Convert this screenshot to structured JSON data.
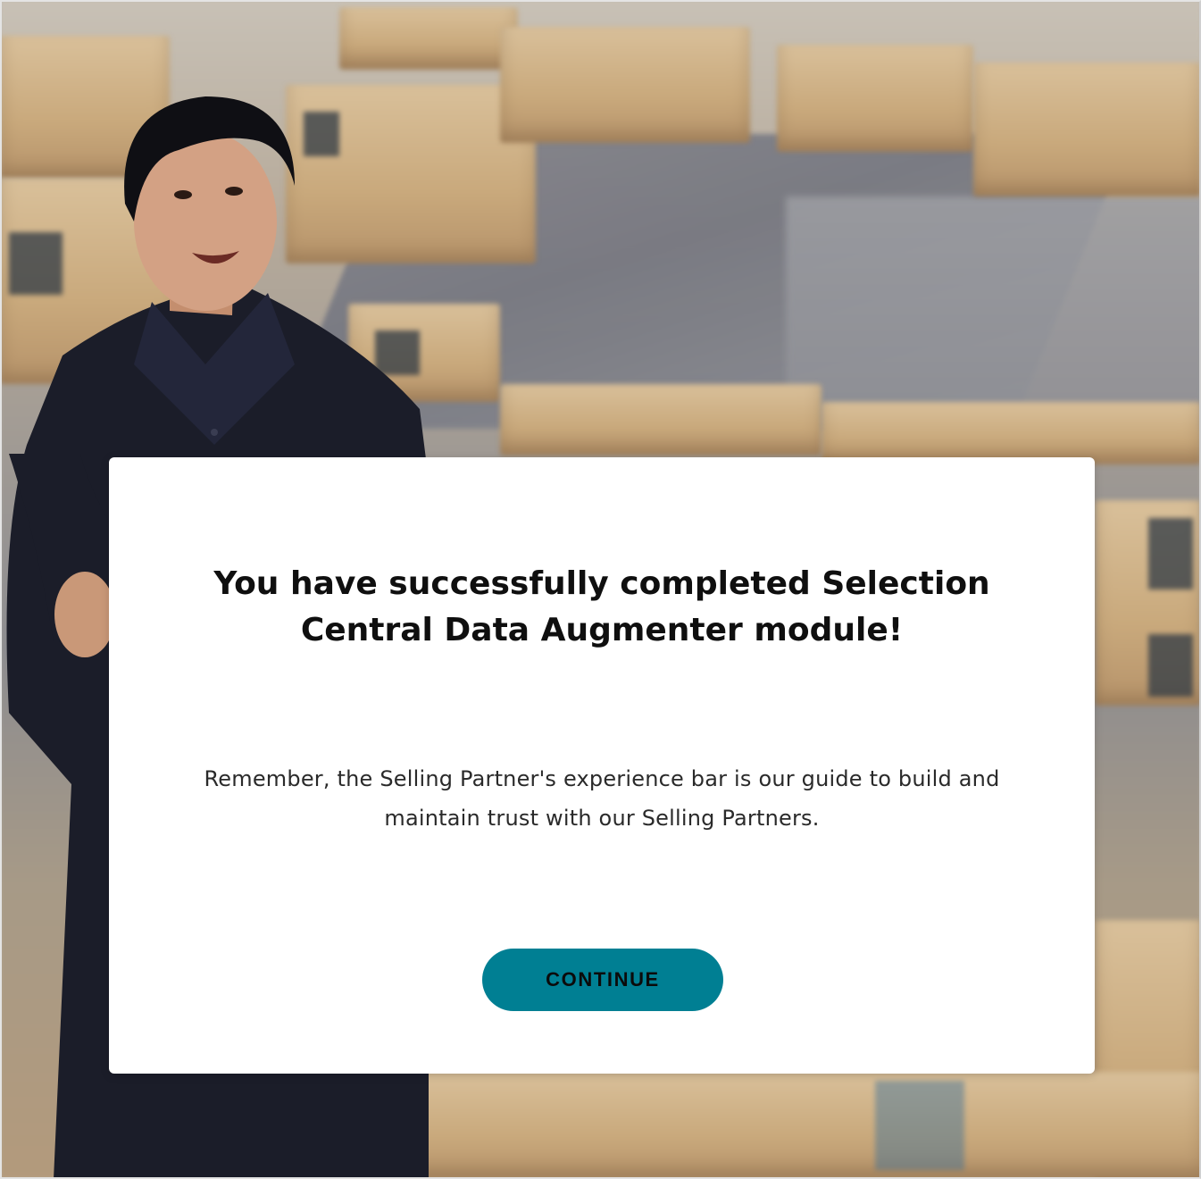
{
  "modal": {
    "title": "You have successfully completed Selection Central Data Augmenter module!",
    "message": "Remember, the Selling Partner's experience bar is our guide to build and maintain trust with our Selling Partners.",
    "continue_label": "CONTINUE"
  },
  "colors": {
    "button_background": "#007f93",
    "modal_background": "#ffffff",
    "title_text": "#0f0f0f"
  },
  "icons": {
    "background": "warehouse-boxes-photo",
    "presenter": "presenter-person-photo"
  }
}
